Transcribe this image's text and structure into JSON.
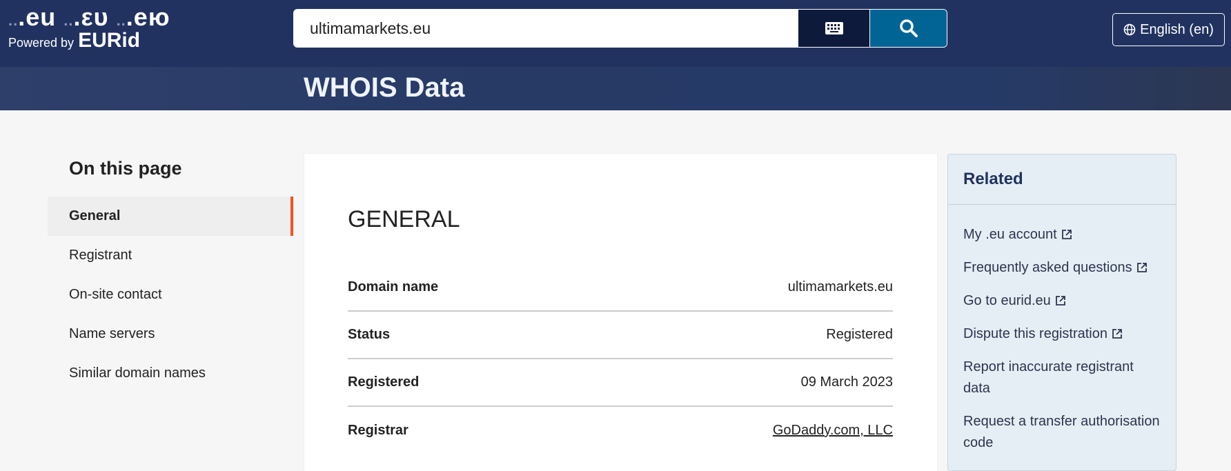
{
  "header": {
    "logo_tlds": [
      ".eu",
      ".ευ",
      ".ею"
    ],
    "logo_powered_by": "Powered by",
    "logo_brand": "EURid",
    "search_value": "ultimamarkets.eu",
    "keyboard_icon": "keyboard-icon",
    "search_icon": "search-icon",
    "language_label": "English (en)"
  },
  "hero": {
    "title": "WHOIS Data"
  },
  "toc": {
    "title": "On this page",
    "items": [
      {
        "label": "General",
        "active": true
      },
      {
        "label": "Registrant"
      },
      {
        "label": "On-site contact"
      },
      {
        "label": "Name servers"
      },
      {
        "label": "Similar domain names"
      }
    ]
  },
  "general": {
    "title": "GENERAL",
    "rows": [
      {
        "key": "Domain name",
        "value": "ultimamarkets.eu"
      },
      {
        "key": "Status",
        "value": "Registered"
      },
      {
        "key": "Registered",
        "value": "09 March 2023"
      },
      {
        "key": "Registrar",
        "value": "GoDaddy.com, LLC",
        "link": true
      }
    ]
  },
  "related": {
    "title": "Related",
    "items": [
      {
        "label": "My .eu account",
        "external": true
      },
      {
        "label": "Frequently asked questions",
        "external": true
      },
      {
        "label": "Go to eurid.eu",
        "external": true
      },
      {
        "label": "Dispute this registration",
        "external": true
      },
      {
        "label": "Report inaccurate registrant data"
      },
      {
        "label": "Request a transfer authorisation code"
      }
    ]
  },
  "colors": {
    "header": "#213260",
    "search_button": "#006595",
    "keyboard_button": "#0e1a3c",
    "active_accent": "#f4511e",
    "related_bg": "#e6eef5"
  }
}
